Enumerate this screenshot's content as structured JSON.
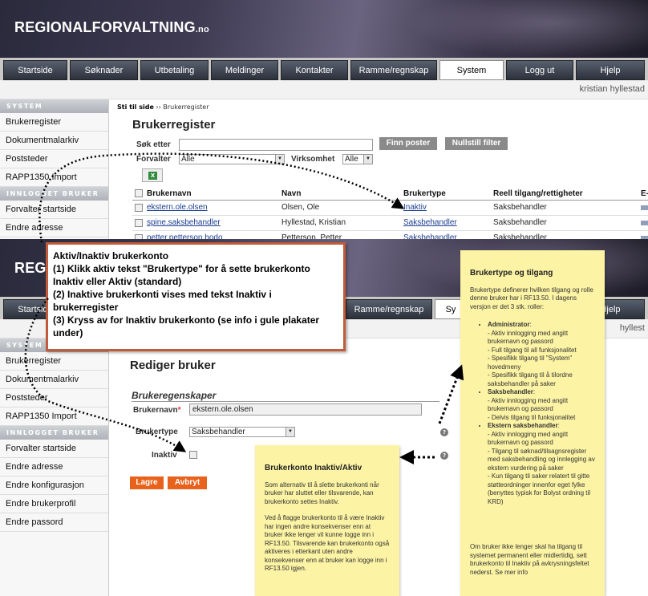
{
  "logo": {
    "main": "REGIONALFORVALTNING",
    "suffix": ".no"
  },
  "nav": [
    "Startside",
    "Søknader",
    "Utbetaling",
    "Meldinger",
    "Kontakter",
    "Ramme/regnskap",
    "System",
    "Logg ut",
    "Hjelp"
  ],
  "nav2": {
    "startside": "Startside",
    "ramme": "Ramme/regnskap",
    "system": "Sy",
    "hjelp": "Hjelp"
  },
  "user": "kristian hyllestad",
  "user2": "hyllest",
  "sidebar1": {
    "head1": "SYSTEM",
    "items1": [
      "Brukerregister",
      "Dokumentmalarkiv",
      "Poststeder",
      "RAPP1350 Import"
    ],
    "head2": "INNLOGGET BRUKER",
    "items2": [
      "Forvalter startside",
      "Endre adresse"
    ]
  },
  "sidebar2": {
    "head1": "SYSTEM",
    "items1": [
      "Brukerregister",
      "Dokumentmalarkiv",
      "Poststeder",
      "RAPP1350 Import"
    ],
    "head2": "INNLOGGET BRUKER",
    "items2": [
      "Forvalter startside",
      "Endre adresse",
      "Endre konfigurasjon",
      "Endre brukerprofil",
      "Endre passord"
    ]
  },
  "breadcrumb": {
    "first": "Sti til side",
    "sep": "››",
    "current": "Brukerregister"
  },
  "register": {
    "title": "Brukerregister",
    "search_label": "Søk etter",
    "forvalter_label": "Forvalter",
    "forvalter_value": "Alle",
    "virksomhet_label": "Virksomhet",
    "virksomhet_value": "Alle",
    "find_button": "Finn poster",
    "reset_button": "Nullstill filter",
    "excel": "X",
    "columns": [
      "Brukernavn",
      "Navn",
      "Brukertype",
      "Reell tilgang/rettigheter",
      "E-"
    ],
    "rows": [
      {
        "username": "ekstern.ole.olsen",
        "name": "Olsen, Ole",
        "type": "Inaktiv",
        "access": "Saksbehandler"
      },
      {
        "username": "spine.saksbehandler",
        "name": "Hyllestad, Kristian",
        "type": "Saksbehandler",
        "access": "Saksbehandler"
      },
      {
        "username": "petter.petterson.bodo",
        "name": "Petterson, Petter",
        "type": "Saksbehandler",
        "access": "Saksbehandler"
      }
    ]
  },
  "callout": {
    "line1": "Aktiv/Inaktiv brukerkonto",
    "line2": "(1) Klikk aktiv tekst \"Brukertype\" for å sette brukerkonto Inaktiv eller Aktiv (standard)",
    "line3": "(2) Inaktive brukerkonti vises med tekst Inaktiv i brukerregister",
    "line4": "(3) Kryss av for Inaktiv brukerkonto (se info i gule plakater under)"
  },
  "edit": {
    "title": "Rediger bruker",
    "section": "Brukeregenskaper",
    "username_label": "Brukernavn",
    "required": "*",
    "username_value": "ekstern.ole.olsen",
    "type_label": "Brukertype",
    "type_value": "Saksbehandler",
    "inactive_label": "Inaktiv",
    "save_button": "Lagre",
    "cancel_button": "Avbryt",
    "help": "?"
  },
  "note_inactive": {
    "title": "Brukerkonto Inaktiv/Aktiv",
    "p1": "Som alternativ til å slette brukerkonti når bruker har sluttet eller tilsvarende, kan brukerkonto settes Inaktiv.",
    "p2": "Ved å flagge brukerkonto til å være Inaktiv har ingen andre konsekvenser enn at bruker ikke lenger vil kunne logge inn i RF13.50. Tilsvarende kan brukerkonto også aktiveres i etterkant uten andre konsekvenser enn at bruker kan logge inn i RF13.50 igjen."
  },
  "note_type": {
    "title": "Brukertype og tilgang",
    "intro": "Brukertype definerer hvilken tilgang og rolle denne bruker har i RF13.50. I dagens versjon er det 3 stk. roller:",
    "roles": [
      {
        "name": "Administrator",
        "lines": [
          "- Aktiv innlogging med angitt brukernavn og passord",
          "- Full tilgang til all funksjonalitet",
          "- Spesifikk tilgang til \"System\" hovedmeny",
          "- Spesifikk tilgang til å tilordne saksbehandler på saker"
        ]
      },
      {
        "name": "Saksbehandler",
        "lines": [
          "- Aktiv innlogging med angitt brukernavn og passord",
          "- Delvis tilgang til funksjonalitet"
        ]
      },
      {
        "name": "Ekstern saksbehandler",
        "lines": [
          "- Aktiv innlogging med angitt brukernavn og passord",
          "- Tilgang til søknad/tilsagnsregister med saksbehandling og innlegging av ekstern vurdering på saker",
          "- Kun tilgang til saker relatert til gitte støtteordninger innenfor eget fylke (benyttes typisk for Bolyst ordning til KRD)"
        ]
      }
    ],
    "outro": "Om bruker ikke lenger skal ha tilgang til systemet permanent eller midlertidig, sett brukerkonto til Inaktiv på avkrysningsfeltet nederst. Se mer info"
  }
}
